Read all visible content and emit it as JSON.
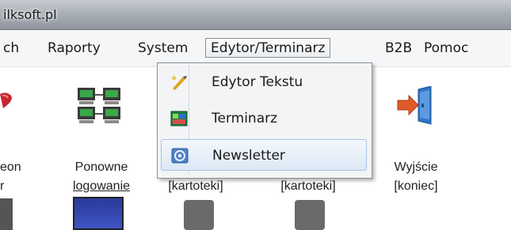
{
  "window": {
    "title": "ilksoft.pl"
  },
  "menubar": {
    "items": [
      {
        "label": "ch"
      },
      {
        "label": "Raporty"
      },
      {
        "label": "System"
      },
      {
        "label": "Edytor/Terminarz"
      },
      {
        "label": "B2B"
      },
      {
        "label": "Pomoc"
      }
    ]
  },
  "dropdown": {
    "items": [
      {
        "label": "Edytor Tekstu",
        "icon": "pen-edit-icon"
      },
      {
        "label": "Terminarz",
        "icon": "calendar-icon"
      },
      {
        "label": "Newsletter",
        "icon": "at-sign-icon"
      }
    ]
  },
  "toolbar": {
    "items": [
      {
        "line1": "eon",
        "line2": "r"
      },
      {
        "line1": "Ponowne",
        "line2": "logowanie"
      },
      {
        "line1": "",
        "line2": "[kartoteki]"
      },
      {
        "line1": "",
        "line2": "[kartoteki]"
      },
      {
        "line1": "Wyjście",
        "line2": "[koniec]"
      }
    ]
  },
  "colors": {
    "titlebar": "#a9afb6",
    "menu_highlight": "#dde8f5",
    "menu_border": "#8a8f95"
  }
}
